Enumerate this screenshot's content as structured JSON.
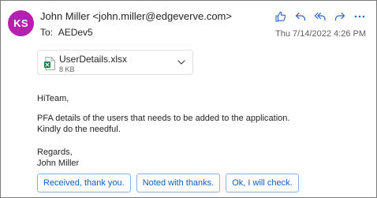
{
  "sender": {
    "initials": "KS",
    "display": "John Miller <john.miller@edgeverve.com>"
  },
  "recipients": {
    "label": "To:",
    "value": "AEDev5"
  },
  "timestamp": "Thu 7/14/2022 4:26 PM",
  "actions": [
    {
      "icon": "thumbs-up-icon"
    },
    {
      "icon": "reply-icon"
    },
    {
      "icon": "reply-all-icon"
    },
    {
      "icon": "forward-icon"
    },
    {
      "icon": "more-icon"
    }
  ],
  "attachment": {
    "name": "UserDetails.xlsx",
    "size": "8 KB",
    "icon": "excel-file-icon"
  },
  "body": {
    "greeting": "HiTeam,",
    "line1": "PFA details of the users that needs to be added to the application.",
    "line2": "Kindly do the needful.",
    "closing": "Regards,",
    "signature": "John Miller"
  },
  "quick_replies": [
    "Received, thank you.",
    "Noted with thanks.",
    "Ok, I will check."
  ],
  "colors": {
    "avatar": "#b620b0",
    "accent": "#0f5fb8",
    "excel_green": "#107c41"
  }
}
